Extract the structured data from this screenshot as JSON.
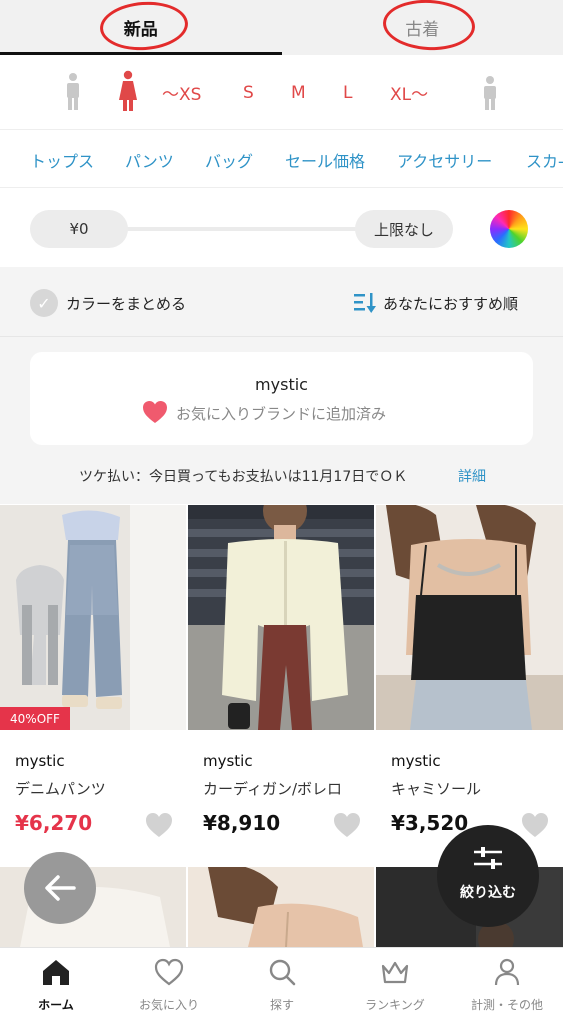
{
  "top_tabs": {
    "new": "新品",
    "used": "古着"
  },
  "sizes": [
    "〜XS",
    "S",
    "M",
    "L",
    "XL〜"
  ],
  "categories": [
    "トップス",
    "パンツ",
    "バッグ",
    "セール価格",
    "アクセサリー",
    "スカ-"
  ],
  "price": {
    "min": "¥0",
    "max": "上限なし"
  },
  "options": {
    "color_merge": "カラーをまとめる",
    "sort": "あなたにおすすめ順"
  },
  "brand_card": {
    "name": "mystic",
    "status": "お気に入りブランドに追加済み"
  },
  "payment_note": {
    "text": "ツケ払い：今日買ってもお支払いは11月17日でＯＫ",
    "link": "詳細"
  },
  "products": [
    {
      "brand": "mystic",
      "name": "デニムパンツ",
      "price": "¥6,270",
      "badge": "40%OFF",
      "sale": true
    },
    {
      "brand": "mystic",
      "name": "カーディガン/ボレロ",
      "price": "¥8,910"
    },
    {
      "brand": "mystic",
      "name": "キャミソール",
      "price": "¥3,520"
    }
  ],
  "filter_button": "絞り込む",
  "bottom_nav": [
    {
      "label": "ホーム",
      "icon": "home-icon"
    },
    {
      "label": "お気に入り",
      "icon": "heart-icon"
    },
    {
      "label": "探す",
      "icon": "search-icon"
    },
    {
      "label": "ランキング",
      "icon": "crown-icon"
    },
    {
      "label": "計測・その他",
      "icon": "person-icon"
    }
  ],
  "colors": {
    "accent_red": "#e04848",
    "link_blue": "#2f93c7",
    "sale_red": "#e5344a"
  }
}
